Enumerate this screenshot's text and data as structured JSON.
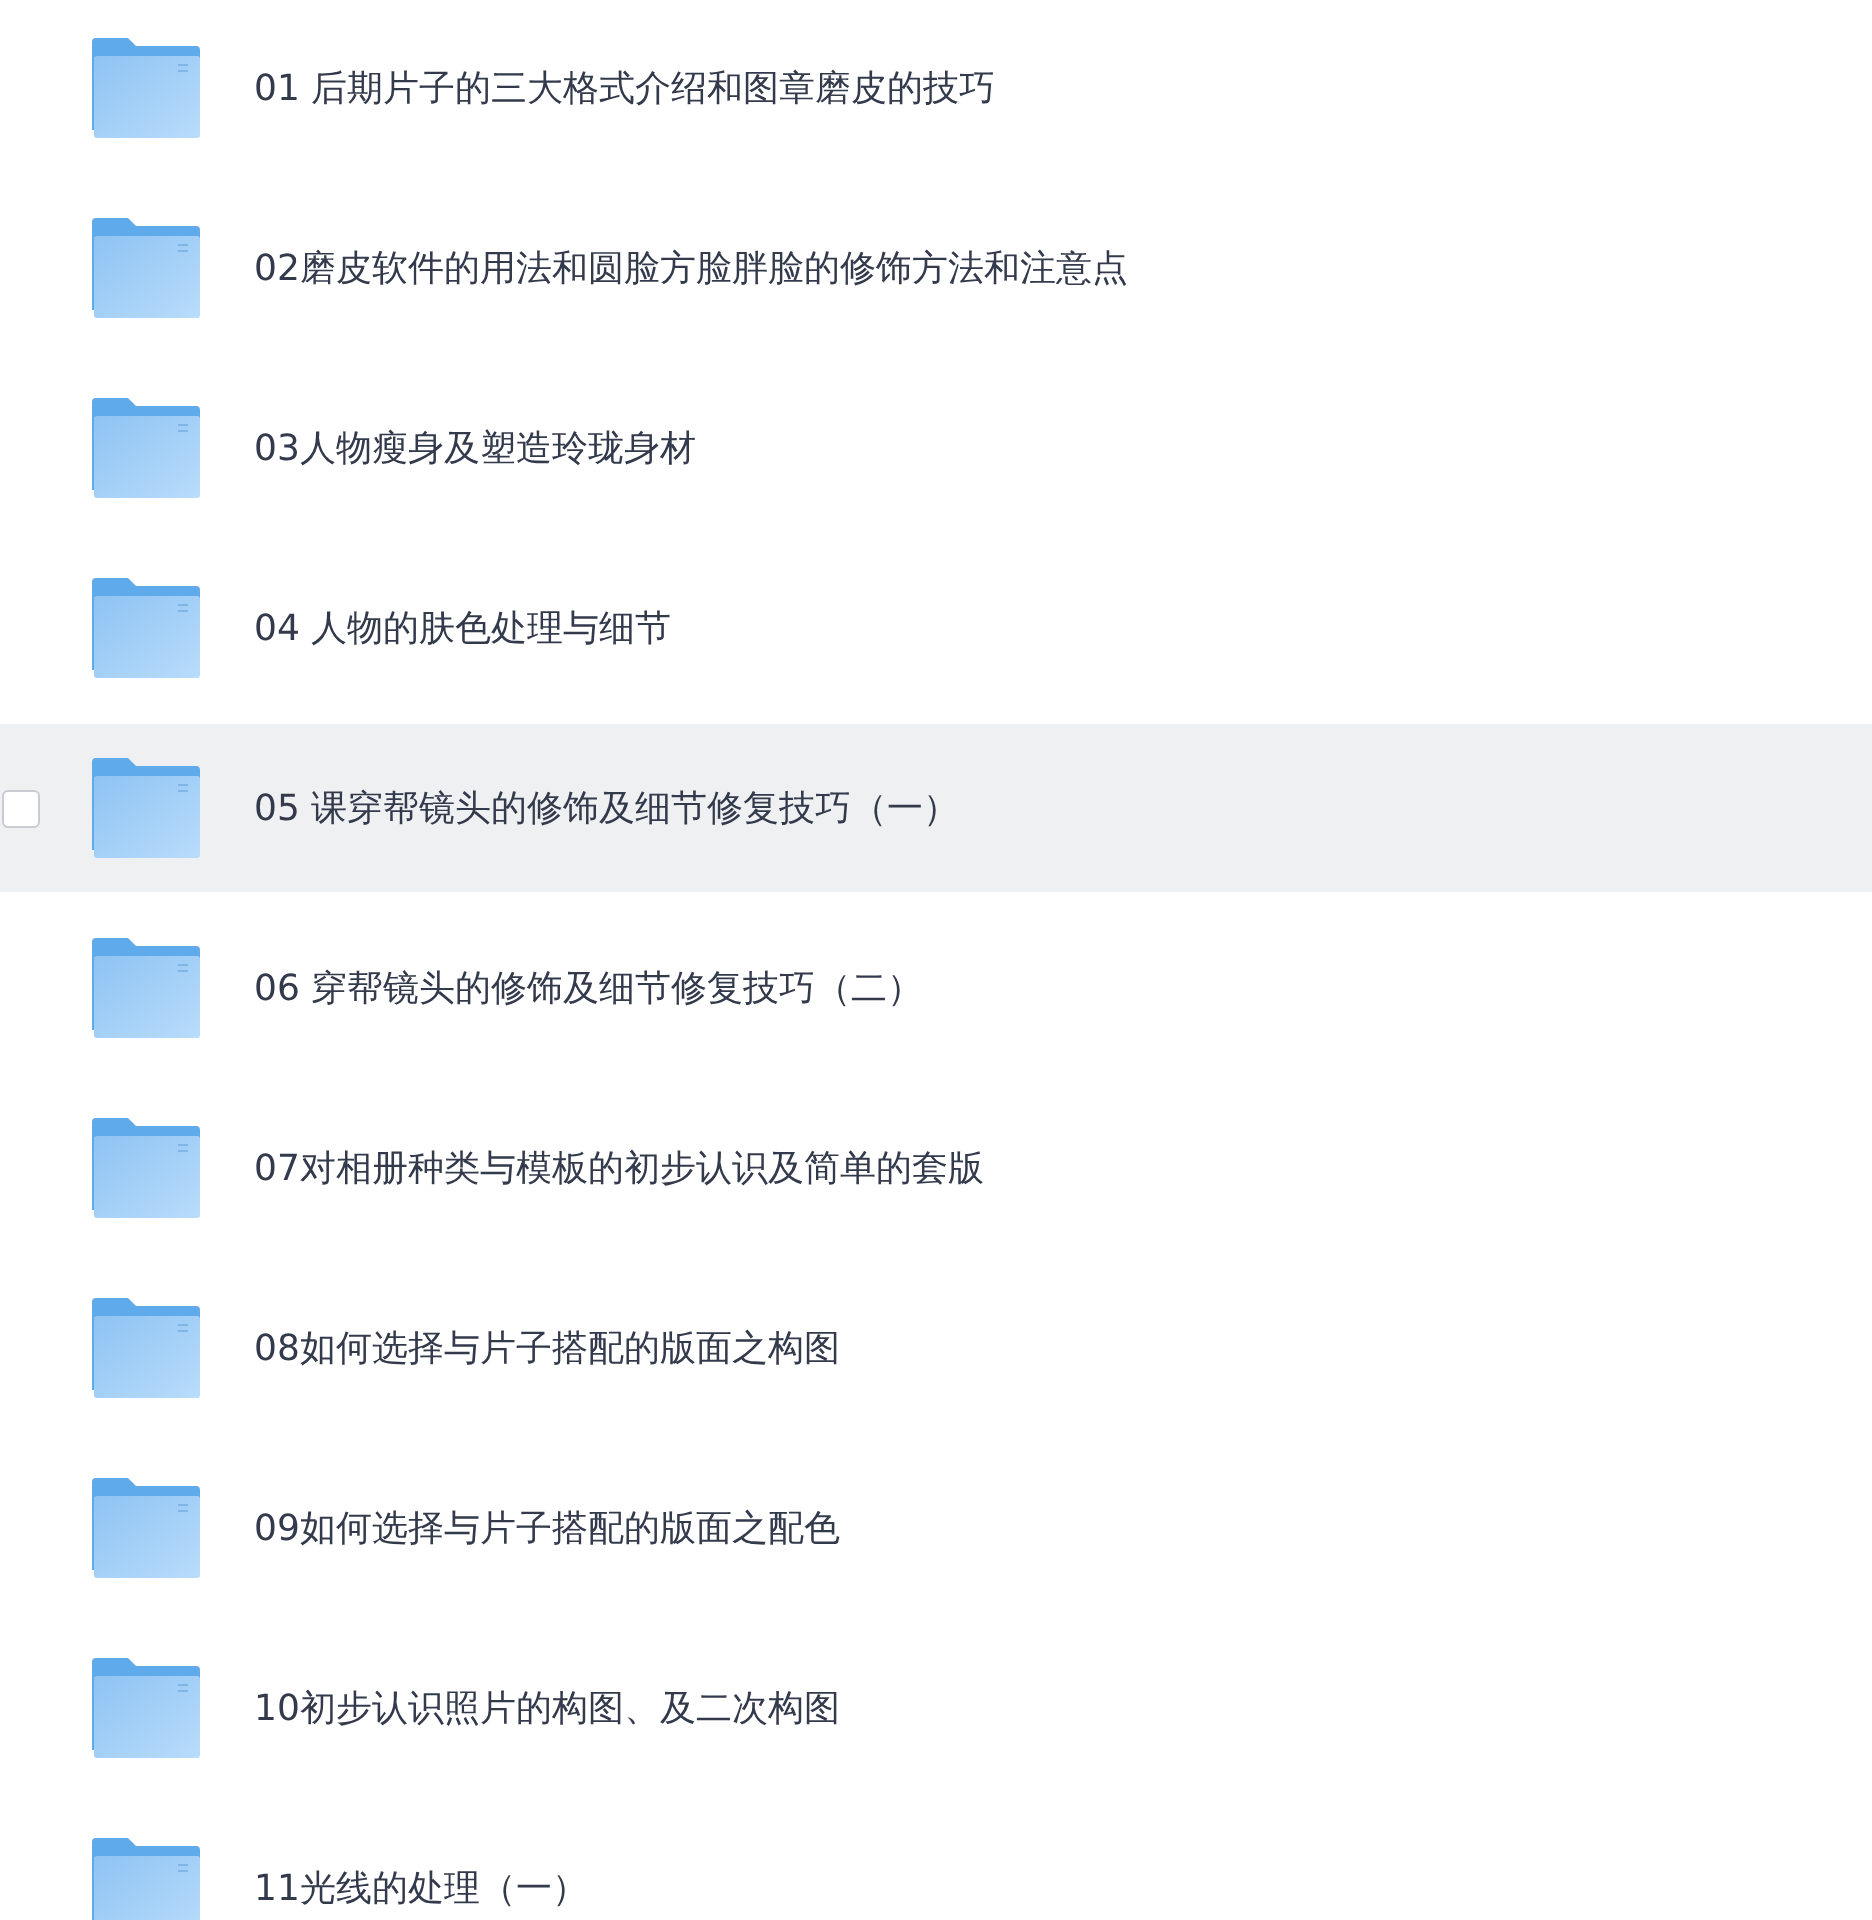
{
  "folders": [
    {
      "name": "01 后期片子的三大格式介绍和图章磨皮的技巧",
      "highlighted": false,
      "checked": false
    },
    {
      "name": "02磨皮软件的用法和圆脸方脸胖脸的修饰方法和注意点",
      "highlighted": false,
      "checked": false
    },
    {
      "name": "03人物瘦身及塑造玲珑身材",
      "highlighted": false,
      "checked": false
    },
    {
      "name": "04 人物的肤色处理与细节",
      "highlighted": false,
      "checked": false
    },
    {
      "name": "05 课穿帮镜头的修饰及细节修复技巧（一）",
      "highlighted": true,
      "checked": false
    },
    {
      "name": "06 穿帮镜头的修饰及细节修复技巧（二）",
      "highlighted": false,
      "checked": false
    },
    {
      "name": "07对相册种类与模板的初步认识及简单的套版",
      "highlighted": false,
      "checked": false
    },
    {
      "name": "08如何选择与片子搭配的版面之构图",
      "highlighted": false,
      "checked": false
    },
    {
      "name": "09如何选择与片子搭配的版面之配色",
      "highlighted": false,
      "checked": false
    },
    {
      "name": "10初步认识照片的构图、及二次构图",
      "highlighted": false,
      "checked": false
    },
    {
      "name": "11光线的处理（一）",
      "highlighted": false,
      "checked": false
    }
  ]
}
